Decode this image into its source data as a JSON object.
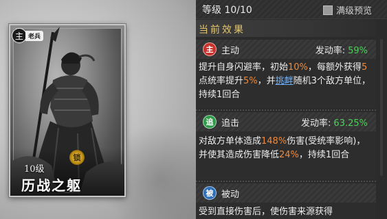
{
  "card": {
    "badge_seal": "主",
    "badge_tag": "老兵",
    "lock_icon": "锁",
    "level": "10级",
    "name": "历战之躯"
  },
  "topbar": {
    "level_text": "等级 10/10",
    "max_preview_label": "满级预览",
    "max_preview_checked": false
  },
  "section_title": "当前效果",
  "skills": [
    {
      "icon": "主",
      "icon_color": "#c8322c",
      "type": "主动",
      "rate_label": "发动率:",
      "rate_value": "59%",
      "body": {
        "t1": "提升自身闪避率，初始",
        "h1": "10%",
        "t2": "，每额外获得",
        "h2": "5",
        "t3": "点统率提升",
        "h3": "5%",
        "t4": "，并",
        "link": "挑衅",
        "t5": "随机3个敌方单位，持续1回合"
      }
    },
    {
      "icon": "追",
      "icon_color": "#2e9a4a",
      "type": "追击",
      "rate_label": "发动率:",
      "rate_value": "63.25%",
      "body": {
        "t1": "对敌方单体造成",
        "h1": "148%",
        "t2": "伤害(受统率影响)，并使其造成伤害降低",
        "h2": "24%",
        "t3": "，持续1回合"
      }
    },
    {
      "icon": "被",
      "icon_color": "#2f6fb8",
      "type": "被动",
      "body": {
        "t1": "受到直接伤害后，使伤害来源获得"
      }
    }
  ],
  "colors": {
    "highlight": "#f08a3c",
    "rate_green": "#4fd05a",
    "link_blue": "#6fb4ff",
    "section_gold": "#e4c66d"
  }
}
